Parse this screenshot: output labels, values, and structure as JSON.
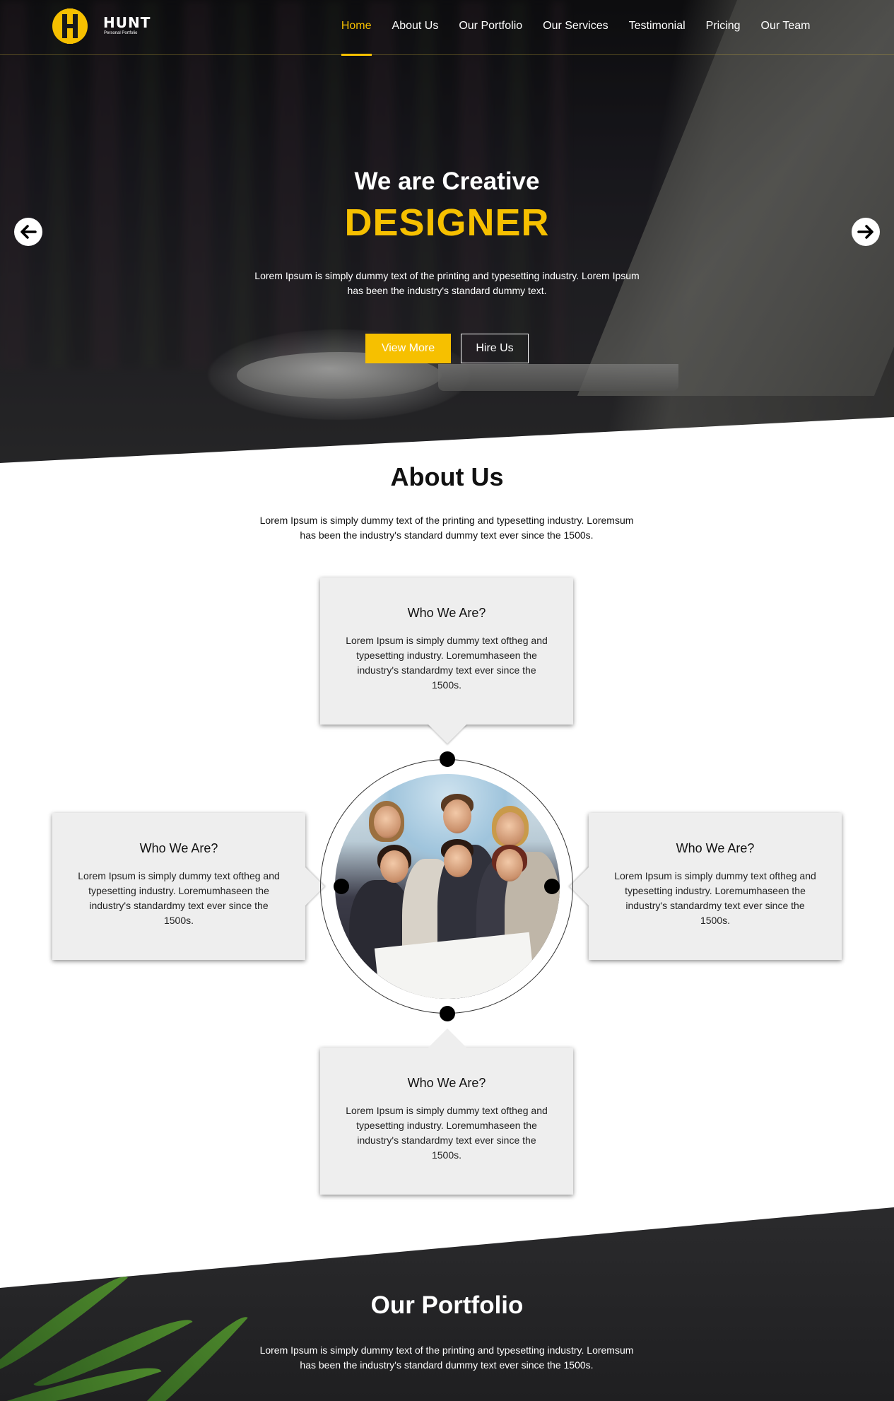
{
  "brand": {
    "name": "HUNT",
    "tagline": "Personal Portfolio",
    "accent": "#f6c000"
  },
  "nav": {
    "items": [
      {
        "label": "Home",
        "active": true
      },
      {
        "label": "About Us"
      },
      {
        "label": "Our Portfolio"
      },
      {
        "label": "Our Services"
      },
      {
        "label": "Testimonial"
      },
      {
        "label": "Pricing"
      },
      {
        "label": "Our Team"
      }
    ]
  },
  "hero": {
    "title": "We are Creative",
    "highlight": "DESIGNER",
    "description": "Lorem Ipsum is simply dummy text of the printing and typesetting industry. Lorem Ipsum has been the industry's standard dummy text.",
    "view_more": "View More",
    "hire_us": "Hire Us",
    "prev_icon": "arrow-left-icon",
    "next_icon": "arrow-right-icon"
  },
  "about": {
    "title": "About Us",
    "description": "Lorem Ipsum is simply dummy text of the printing and typesetting industry. Loremsum has been the industry's standard dummy text ever since the 1500s.",
    "cards": [
      {
        "title": "Who We Are?",
        "text": "Lorem Ipsum is simply dummy text oftheg and typesetting industry. Loremumhaseen the industry's standardmy text ever since the 1500s."
      },
      {
        "title": "Who We Are?",
        "text": "Lorem Ipsum is simply dummy text oftheg and typesetting industry. Loremumhaseen the industry's standardmy text ever since the 1500s."
      },
      {
        "title": "Who We Are?",
        "text": "Lorem Ipsum is simply dummy text oftheg and typesetting industry. Loremumhaseen the industry's standardmy text ever since the 1500s."
      },
      {
        "title": "Who We Are?",
        "text": "Lorem Ipsum is simply dummy text oftheg and typesetting industry. Loremumhaseen the industry's standardmy text ever since the 1500s."
      }
    ]
  },
  "portfolio": {
    "title": "Our Portfolio",
    "description": "Lorem Ipsum is simply dummy text of the printing and typesetting industry. Loremsum has been the industry's standard dummy text ever since the 1500s."
  }
}
